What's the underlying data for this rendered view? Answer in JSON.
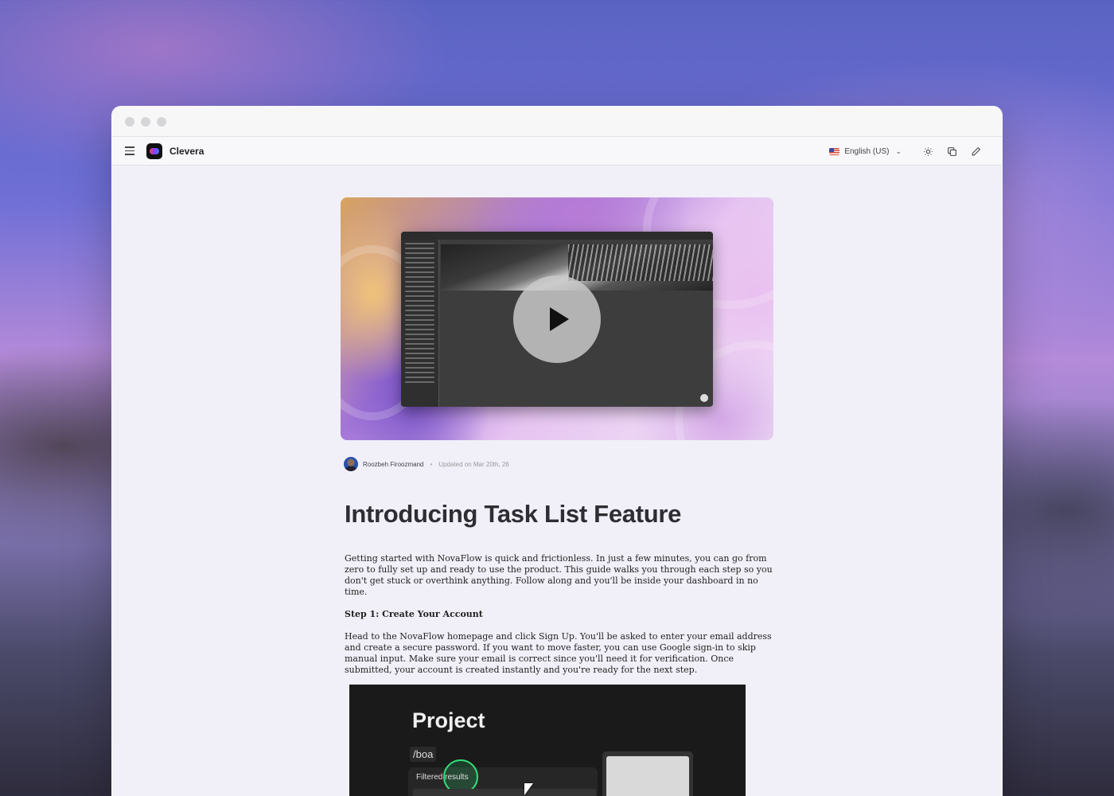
{
  "appbar": {
    "app_name": "Clevera",
    "language": "English (US)",
    "icons": [
      "menu-icon",
      "theme-icon",
      "copy-icon",
      "edit-icon"
    ]
  },
  "hero": {
    "type": "video-thumbnail",
    "icon": "play-icon"
  },
  "meta": {
    "author": "Roozbeh Firoozmand",
    "updated": "Updated on Mar 20th, 26"
  },
  "article": {
    "title": "Introducing Task List Feature",
    "intro": "Getting started with NovaFlow is quick and frictionless. In just a few minutes, you can go from zero to fully set up and ready to use the product. This guide walks you through each step so you don't get stuck or overthink anything. Follow along and you'll be inside your dashboard in no time.",
    "step1_heading": "Step 1: Create Your Account",
    "step1_body": "Head to the NovaFlow homepage and click Sign Up. You'll be asked to enter your email address and create a secure password. If you want to move faster, you can use Google sign-in to skip manual input. Make sure your email is correct since you'll need it for verification. Once submitted, your account is created instantly and you're ready for the next step."
  },
  "screenshot": {
    "title": "Project",
    "command": "/boa",
    "filter_label": "Filtered results"
  }
}
